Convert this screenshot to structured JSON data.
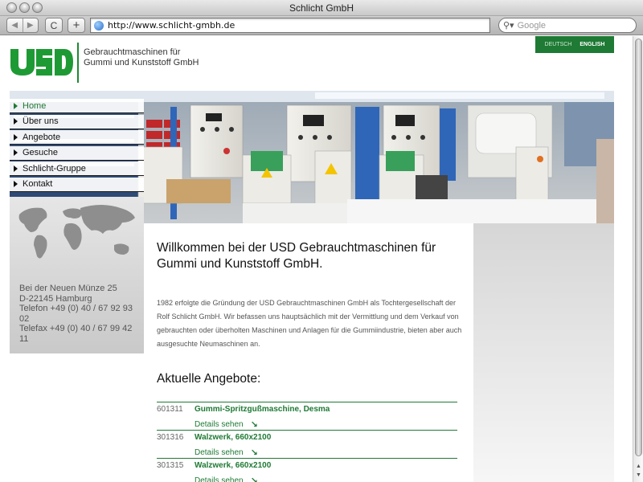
{
  "window": {
    "title": "Schlicht GmbH"
  },
  "toolbar": {
    "back": "◀",
    "forward": "▶",
    "reload": "C",
    "add": "+",
    "url": "http://www.schlicht-gmbh.de",
    "search_placeholder": "Google"
  },
  "header": {
    "logo_text": "USD",
    "company_line1": "Gebrauchtmaschinen für",
    "company_line2": "Gummi und Kunststoff GmbH",
    "lang_de": "DEUTSCH",
    "lang_en": "ENGLISH"
  },
  "nav": {
    "items": [
      {
        "label": "Home"
      },
      {
        "label": "Über uns"
      },
      {
        "label": "Angebote"
      },
      {
        "label": "Gesuche"
      },
      {
        "label": "Schlicht-Gruppe"
      },
      {
        "label": "Kontakt"
      }
    ]
  },
  "address": {
    "street": "Bei der Neuen Münze 25",
    "city": "D-22145 Hamburg",
    "phone": "Telefon +49 (0) 40 / 67 92 93 02",
    "fax": "Telefax +49 (0) 40 / 67 99 42 11"
  },
  "main": {
    "heading": "Willkommen bei der USD Gebrauchtmaschinen für Gummi und Kunststoff GmbH.",
    "intro": "1982 erfolgte die Gründung der USD Gebrauchtmaschinen GmbH als Tochtergesellschaft der Rolf Schlicht GmbH. Wir befassen uns hauptsächlich mit der Vermittlung und dem Verkauf von gebrauchten oder überholten Maschinen und Anlagen für die Gummiindustrie, bieten aber auch ausgesuchte Neumaschinen an.",
    "offers_heading": "Aktuelle Angebote:",
    "details_label": "Details sehen",
    "details_arrow": "↘",
    "offers": [
      {
        "id": "601311",
        "title": "Gummi-Spritzgußmaschine, Desma"
      },
      {
        "id": "301316",
        "title": "Walzwerk, 660x2100"
      },
      {
        "id": "301315",
        "title": "Walzwerk, 660x2100"
      }
    ]
  },
  "colors": {
    "brand_green": "#1e7a34"
  }
}
